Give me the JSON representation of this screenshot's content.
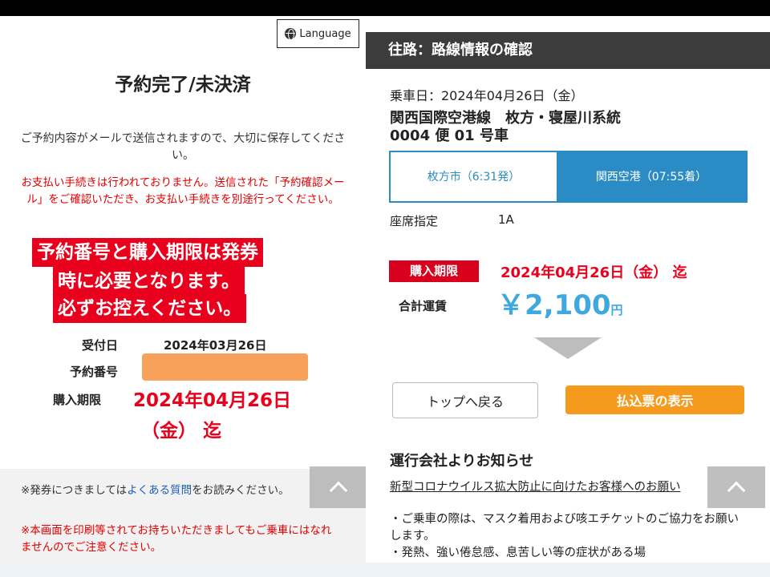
{
  "left": {
    "language_label": "Language",
    "title": "予約完了/未決済",
    "note1": "ご予約内容がメールで送信されますので、大切に保存してください。",
    "note2": "お支払い手続きは行われておりません。送信された「予約確認メール」をご確認いただき、お支払い手続きを別途行ってください。",
    "warning_lines": [
      "予約番号と購入期限は発券",
      "時に必要となります。",
      "必ずお控えください。"
    ],
    "fields": {
      "received_label": "受付日",
      "received_value": "2024年03月26日",
      "reservation_label": "予約番号",
      "deadline_label": "購入期限",
      "deadline_value_line1": "2024年04月26日",
      "deadline_value_line2": "（金） 迄"
    },
    "footer": {
      "faq_prefix": "※発券につきましては",
      "faq_link": "よくある質問",
      "faq_suffix": "をお読みください。",
      "print_note": "※本画面を印刷等されてお持ちいただきましてもご乗車にはなれませんのでご注意ください。"
    }
  },
  "right": {
    "header": "往路：路線情報の確認",
    "ride_date": "乗車日：2024年04月26日（金）",
    "route_line1": "関西国際空港線　枚方・寝屋川系統",
    "route_line2": "0004 便 01 号車",
    "from_stop": "枚方市（6:31発）",
    "to_stop": "関西空港（07:55着）",
    "seat_label": "座席指定",
    "seat_value": "1A",
    "deadline_badge": "購入期限",
    "deadline_value": "2024年04月26日（金） 迄",
    "fare_label": "合計運賃",
    "fare_value": "￥2,100",
    "fare_unit": "円",
    "back_button": "トップへ戻る",
    "pay_button": "払込票の表示",
    "news_title": "運行会社よりお知らせ",
    "news_link": "新型コロナウイルス拡大防止に向けたお客様へのお願い",
    "news_body": "・ご乗車の際は、マスク着用および咳エチケットのご協力をお願いします。\n・発熱、強い倦怠感、息苦しい等の症状がある場"
  },
  "icons": {
    "language": "globe-icon",
    "scroll_top": "chevron-up-icon",
    "next_step": "down-arrow-icon"
  },
  "colors": {
    "alert_red": "#e8001c",
    "route_blue": "#2b8bc4",
    "fare_blue": "#3fa9df",
    "pay_orange": "#f59a1d",
    "reservation_mask": "#f7a15a"
  }
}
